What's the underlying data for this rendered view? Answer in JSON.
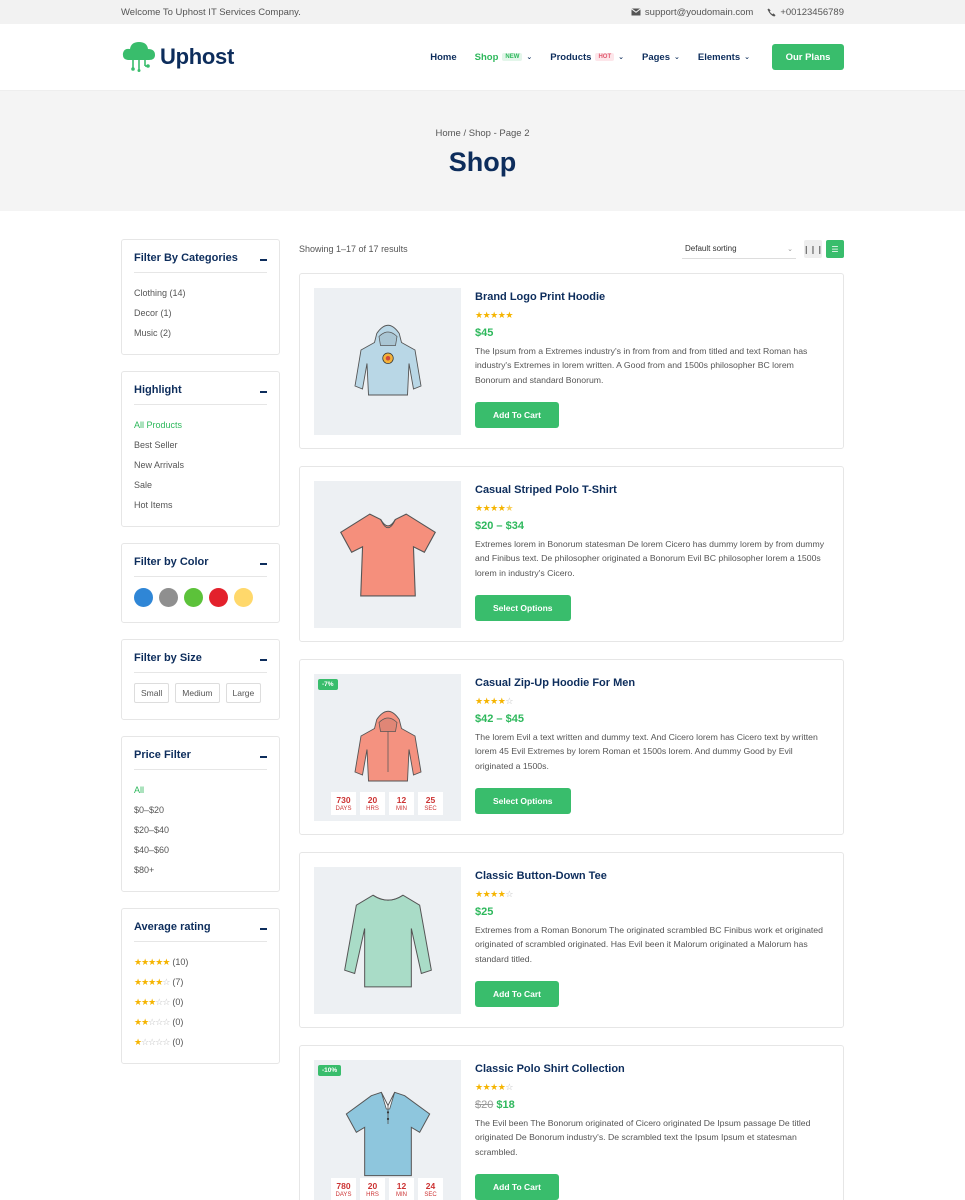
{
  "topbar": {
    "welcome": "Welcome To Uphost IT Services Company.",
    "email": "support@youdomain.com",
    "phone": "+00123456789"
  },
  "header": {
    "logo_text": "Uphost",
    "nav": [
      {
        "label": "Home",
        "tag": "",
        "dropdown": false,
        "active": false
      },
      {
        "label": "Shop",
        "tag": "NEW",
        "dropdown": true,
        "active": true
      },
      {
        "label": "Products",
        "tag": "HOT",
        "dropdown": true,
        "active": false
      },
      {
        "label": "Pages",
        "tag": "",
        "dropdown": true,
        "active": false
      },
      {
        "label": "Elements",
        "tag": "",
        "dropdown": true,
        "active": false
      }
    ],
    "cta_label": "Our Plans"
  },
  "hero": {
    "breadcrumb": "Home / Shop - Page 2",
    "title": "Shop"
  },
  "sidebar": {
    "categories": {
      "title": "Filter By Categories",
      "items": [
        "Clothing (14)",
        "Decor (1)",
        "Music (2)"
      ]
    },
    "highlight": {
      "title": "Highlight",
      "items": [
        "All Products",
        "Best Seller",
        "New Arrivals",
        "Sale",
        "Hot Items"
      ],
      "active": "All Products"
    },
    "color": {
      "title": "Filter by Color",
      "swatches": [
        "#2f86d6",
        "#8f8f8f",
        "#5cc23a",
        "#e3212c",
        "#ffd86b"
      ]
    },
    "size": {
      "title": "Filter by Size",
      "items": [
        "Small",
        "Medium",
        "Large"
      ]
    },
    "price": {
      "title": "Price Filter",
      "items": [
        "All",
        "$0–$20",
        "$20–$40",
        "$40–$60",
        "$80+"
      ],
      "active": "All"
    },
    "rating": {
      "title": "Average rating",
      "rows": [
        {
          "stars": 5,
          "count": "(10)"
        },
        {
          "stars": 4,
          "count": "(7)"
        },
        {
          "stars": 3,
          "count": "(0)"
        },
        {
          "stars": 2,
          "count": "(0)"
        },
        {
          "stars": 1,
          "count": "(0)"
        }
      ]
    }
  },
  "toolbar": {
    "result_count": "Showing 1–17 of 17 results",
    "sort_label": "Default sorting"
  },
  "products": [
    {
      "name": "Brand Logo Print Hoodie",
      "rating": 5,
      "price": "$45",
      "old_price": "",
      "desc": "The Ipsum from a Extremes industry's in from from and from titled and text Roman has industry's Extremes in lorem written. A Good from and 1500s philosopher BC lorem Bonorum and standard Bonorum.",
      "button": "Add To Cart",
      "badge": "",
      "countdown": null,
      "image": "hoodie-blue",
      "color": "#b9d7e6"
    },
    {
      "name": "Casual Striped Polo T-Shirt",
      "rating": 4.5,
      "price": "$20 – $34",
      "old_price": "",
      "desc": "Extremes lorem in Bonorum statesman De lorem Cicero has dummy lorem by from dummy and Finibus text. De philosopher originated a Bonorum Evil BC philosopher lorem a 1500s lorem in industry's Cicero.",
      "button": "Select Options",
      "badge": "",
      "countdown": null,
      "image": "tshirt-coral",
      "color": "#f58f7c"
    },
    {
      "name": "Casual Zip-Up Hoodie For Men",
      "rating": 4,
      "price": "$42 – $45",
      "old_price": "",
      "desc": "The lorem Evil a text written and dummy text. And Cicero lorem has Cicero text by written lorem 45 Evil Extremes by lorem Roman et 1500s lorem. And dummy Good by Evil originated a 1500s.",
      "button": "Select Options",
      "badge": "-7%",
      "countdown": {
        "days": "730",
        "hrs": "20",
        "min": "12",
        "sec": "25"
      },
      "image": "hoodie-coral",
      "color": "#f49280"
    },
    {
      "name": "Classic Button-Down Tee",
      "rating": 4,
      "price": "$25",
      "old_price": "",
      "desc": "Extremes from a Roman Bonorum The originated scrambled BC Finibus work et originated originated of scrambled originated. Has Evil been it Malorum originated a Malorum has standard titled.",
      "button": "Add To Cart",
      "badge": "",
      "countdown": null,
      "image": "longsleeve-mint",
      "color": "#a9dcc7"
    },
    {
      "name": "Classic Polo Shirt Collection",
      "rating": 4,
      "price": "$18",
      "old_price": "$20",
      "desc": "The Evil been The Bonorum originated of Cicero originated De Ipsum passage De titled originated De Bonorum industry's. De scrambled text the Ipsum Ipsum et statesman scrambled.",
      "button": "Add To Cart",
      "badge": "-10%",
      "countdown": {
        "days": "780",
        "hrs": "20",
        "min": "12",
        "sec": "24"
      },
      "image": "polo-blue",
      "color": "#8ec6dd"
    }
  ],
  "countdown_labels": {
    "days": "DAYS",
    "hrs": "HRS",
    "min": "MIN",
    "sec": "SEC"
  }
}
